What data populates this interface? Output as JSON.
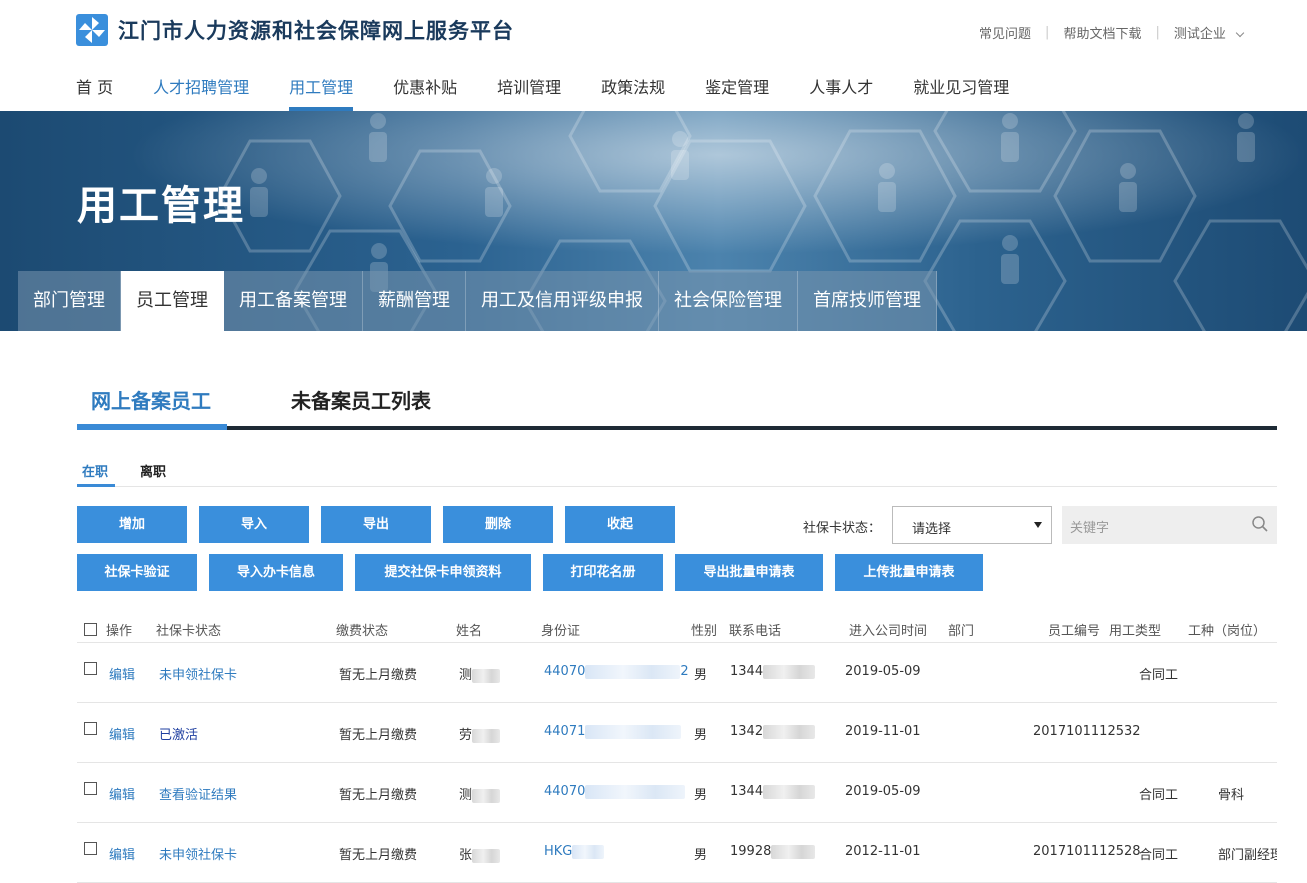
{
  "header": {
    "site_title": "江门市人力资源和社会保障网上服务平台",
    "links": [
      "常见问题",
      "帮助文档下载",
      "测试企业"
    ]
  },
  "main_nav": [
    {
      "label": "首 页",
      "style": "normal"
    },
    {
      "label": "人才招聘管理",
      "style": "blue"
    },
    {
      "label": "用工管理",
      "style": "active"
    },
    {
      "label": "优惠补贴",
      "style": "normal"
    },
    {
      "label": "培训管理",
      "style": "normal"
    },
    {
      "label": "政策法规",
      "style": "normal"
    },
    {
      "label": "鉴定管理",
      "style": "normal"
    },
    {
      "label": "人事人才",
      "style": "normal"
    },
    {
      "label": "就业见习管理",
      "style": "normal"
    }
  ],
  "banner": {
    "title": "用工管理",
    "sub_nav": [
      "部门管理",
      "员工管理",
      "用工备案管理",
      "薪酬管理",
      "用工及信用评级申报",
      "社会保险管理",
      "首席技师管理"
    ],
    "active_index": 1
  },
  "content_tabs": {
    "active": "网上备案员工",
    "other": "未备案员工列表"
  },
  "status_tabs": {
    "active": "在职",
    "other": "离职"
  },
  "buttons_row1": [
    "增加",
    "导入",
    "导出",
    "删除",
    "收起"
  ],
  "buttons_row2": [
    "社保卡验证",
    "导入办卡信息",
    "提交社保卡申领资料",
    "打印花名册",
    "导出批量申请表",
    "上传批量申请表"
  ],
  "filter": {
    "label": "社保卡状态：",
    "select_value": "请选择",
    "search_placeholder": "关键字"
  },
  "table": {
    "headers": [
      "操作",
      "社保卡状态",
      "缴费状态",
      "姓名",
      "身份证",
      "性别",
      "联系电话",
      "进入公司时间",
      "部门",
      "员工编号",
      "用工类型",
      "工种（岗位）"
    ],
    "rows": [
      {
        "action": "编辑",
        "card_status": "未申领社保卡",
        "card_style": "link",
        "pay_status": "暂无上月缴费",
        "name": "测",
        "id_prefix": "44070",
        "id_suffix": "2",
        "gender": "男",
        "phone": "1344",
        "join_date": "2019-05-09",
        "dept": "",
        "emp_no": "",
        "emp_type": "合同工",
        "job": ""
      },
      {
        "action": "编辑",
        "card_status": "已激活",
        "card_style": "dark-link",
        "pay_status": "暂无上月缴费",
        "name": "劳",
        "id_prefix": "44071",
        "id_suffix": "",
        "gender": "男",
        "phone": "1342",
        "join_date": "2019-11-01",
        "dept": "",
        "emp_no": "2017101112532",
        "emp_type": "",
        "job": ""
      },
      {
        "action": "编辑",
        "card_status": "查看验证结果",
        "card_style": "link",
        "pay_status": "暂无上月缴费",
        "name": "测",
        "id_prefix": "44070",
        "id_suffix": "",
        "gender": "男",
        "phone": "1344",
        "join_date": "2019-05-09",
        "dept": "",
        "emp_no": "",
        "emp_type": "合同工",
        "job": "骨科"
      },
      {
        "action": "编辑",
        "card_status": "未申领社保卡",
        "card_style": "link",
        "pay_status": "暂无上月缴费",
        "name": "张",
        "id_prefix": "HKG",
        "id_suffix": "",
        "gender": "男",
        "phone": "19928",
        "join_date": "2012-11-01",
        "dept": "",
        "emp_no": "2017101112528",
        "emp_type": "合同工",
        "job": "部门副经理"
      }
    ]
  },
  "icons": {
    "logo": "pinwheel-logo-icon",
    "dropdown": "chevron-down-icon",
    "search": "search-icon"
  },
  "colors": {
    "primary": "#3a8fdc",
    "nav_active": "#2f7bbf",
    "title": "#1a3a5c"
  }
}
